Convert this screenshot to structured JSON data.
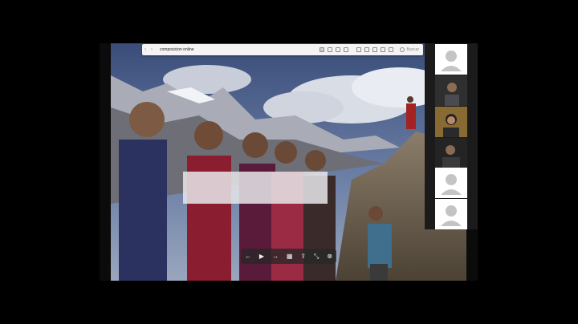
{
  "viewer": {
    "title": "composicion online",
    "search_label": "Buscar"
  },
  "participants": [
    {
      "kind": "avatar"
    },
    {
      "kind": "video",
      "tone": "#3a3a3a"
    },
    {
      "kind": "video",
      "tone": "#7a5a2a"
    },
    {
      "kind": "video",
      "tone": "#2a2a2a"
    },
    {
      "kind": "avatar"
    },
    {
      "kind": "avatar"
    }
  ],
  "controls": [
    "◀",
    "▶",
    "▶",
    "▦",
    "⇪",
    "⤡",
    "⊗"
  ]
}
